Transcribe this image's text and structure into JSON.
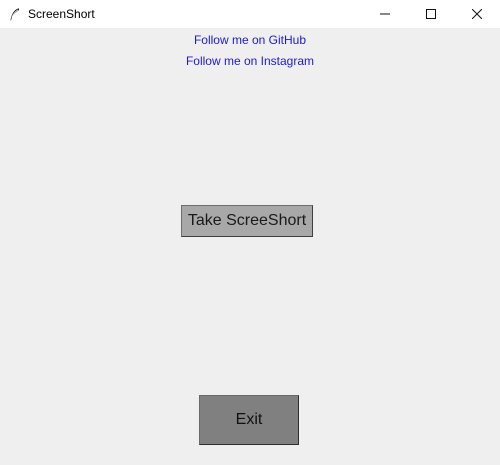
{
  "window": {
    "title": "ScreenShort",
    "icon": "feather-icon",
    "controls": {
      "minimize_icon": "minimize-icon",
      "maximize_icon": "maximize-icon",
      "close_icon": "close-icon"
    }
  },
  "links": {
    "github": "Follow me on GitHub",
    "instagram": "Follow me on Instagram"
  },
  "buttons": {
    "take_screenshot": "Take ScreeShort",
    "exit": "Exit"
  },
  "colors": {
    "titlebar_bg": "#ffffff",
    "window_bg": "#efefef",
    "link_color": "#1d1bd6",
    "take_button_bg": "#a8a8a8",
    "exit_button_bg": "#808080"
  }
}
